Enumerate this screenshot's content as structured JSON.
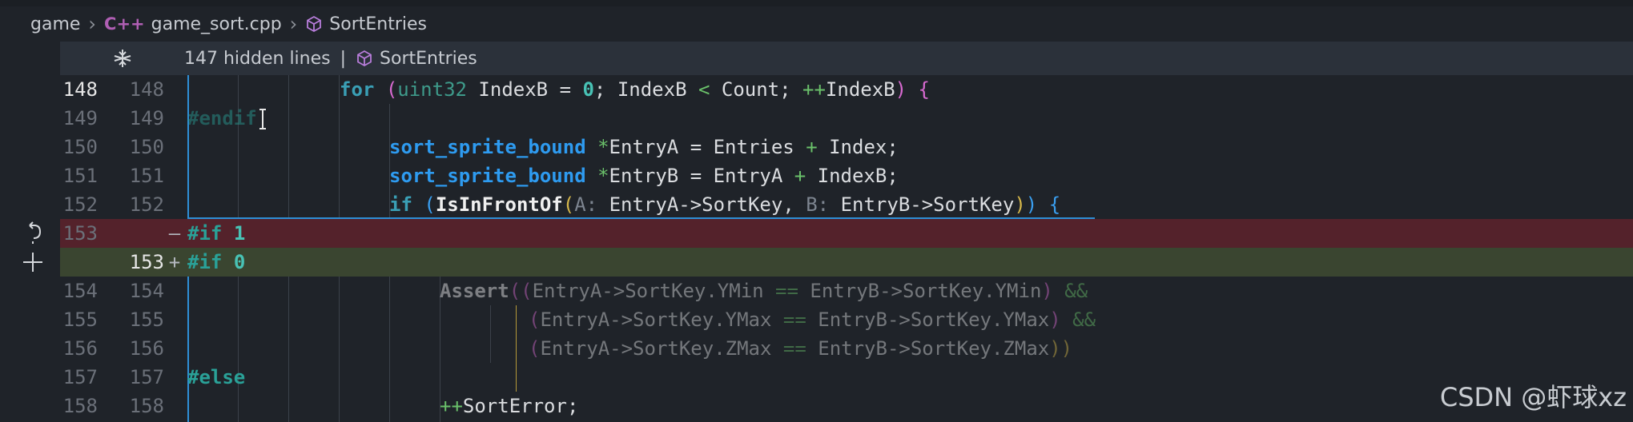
{
  "breadcrumb": {
    "folder": "game",
    "file_icon": "C++",
    "file": "game_sort.cpp",
    "symbol": "SortEntries"
  },
  "hidden_bar": {
    "label": "147 hidden lines",
    "separator": "|",
    "symbol": "SortEntries"
  },
  "lines": [
    {
      "orig": "148",
      "mod": "148"
    },
    {
      "orig": "149",
      "mod": "149"
    },
    {
      "orig": "150",
      "mod": "150"
    },
    {
      "orig": "151",
      "mod": "151"
    },
    {
      "orig": "152",
      "mod": "152"
    },
    {
      "orig": "153",
      "mod": "",
      "marker": "—"
    },
    {
      "orig": "",
      "mod": "153",
      "marker": "+"
    },
    {
      "orig": "154",
      "mod": "154"
    },
    {
      "orig": "155",
      "mod": "155"
    },
    {
      "orig": "156",
      "mod": "156"
    },
    {
      "orig": "157",
      "mod": "157"
    },
    {
      "orig": "158",
      "mod": "158"
    }
  ],
  "code": {
    "l148": {
      "kw": "for",
      "p1": "(",
      "ty": "uint32",
      "a": " IndexB = ",
      "n0": "0",
      "b": "; IndexB ",
      "lt": "<",
      "c": " Count; ",
      "pp": "++",
      "d": "IndexB",
      "p2": ")",
      "brace": "{"
    },
    "l149": {
      "pp": "#endif"
    },
    "l150": {
      "ty": "sort_sprite_bound",
      "star": "*",
      "a": "EntryA = Entries ",
      "plus": "+",
      "b": " Index;"
    },
    "l151": {
      "ty": "sort_sprite_bound",
      "star": "*",
      "a": "EntryB = EntryA ",
      "plus": "+",
      "b": " IndexB;"
    },
    "l152": {
      "kw": "if",
      "p1": "(",
      "fn": "IsInFrontOf",
      "p2": "(",
      "hintA": "A:",
      "argA": "EntryA->SortKey, ",
      "hintB": "B:",
      "argB": "EntryB->SortKey",
      "p3": ")",
      "p4": ")",
      "brace": "{"
    },
    "l153a": {
      "pp": "#if",
      "num": "1"
    },
    "l153b": {
      "pp": "#if",
      "num": "0"
    },
    "l154": {
      "fn": "Assert",
      "p1": "((",
      "a": "EntryA->SortKey.YMin ",
      "eq": "==",
      "b": " EntryB->SortKey.YMin",
      "p2": ")",
      "and": "&&"
    },
    "l155": {
      "p1": "(",
      "a": "EntryA->SortKey.YMax ",
      "eq": "==",
      "b": " EntryB->SortKey.YMax",
      "p2": ")",
      "and": "&&"
    },
    "l156": {
      "p1": "(",
      "a": "EntryA->SortKey.ZMax ",
      "eq": "==",
      "b": " EntryB->SortKey.ZMax",
      "p2": "))"
    },
    "l157": {
      "pp": "#else"
    },
    "l158": {
      "pp": "++",
      "a": "SortError;"
    }
  },
  "watermark": "CSDN @虾球xz",
  "icons": {
    "unfold": "unfold-icon",
    "symbol": "cube-icon",
    "revert": "revert-icon",
    "stage": "plus-icon",
    "cursor": "text-cursor-icon"
  },
  "colors": {
    "removed_bg": "#54222b",
    "added_bg": "#3a4530",
    "keyword": "#3a9fb5",
    "function": "#2e9bf0"
  }
}
